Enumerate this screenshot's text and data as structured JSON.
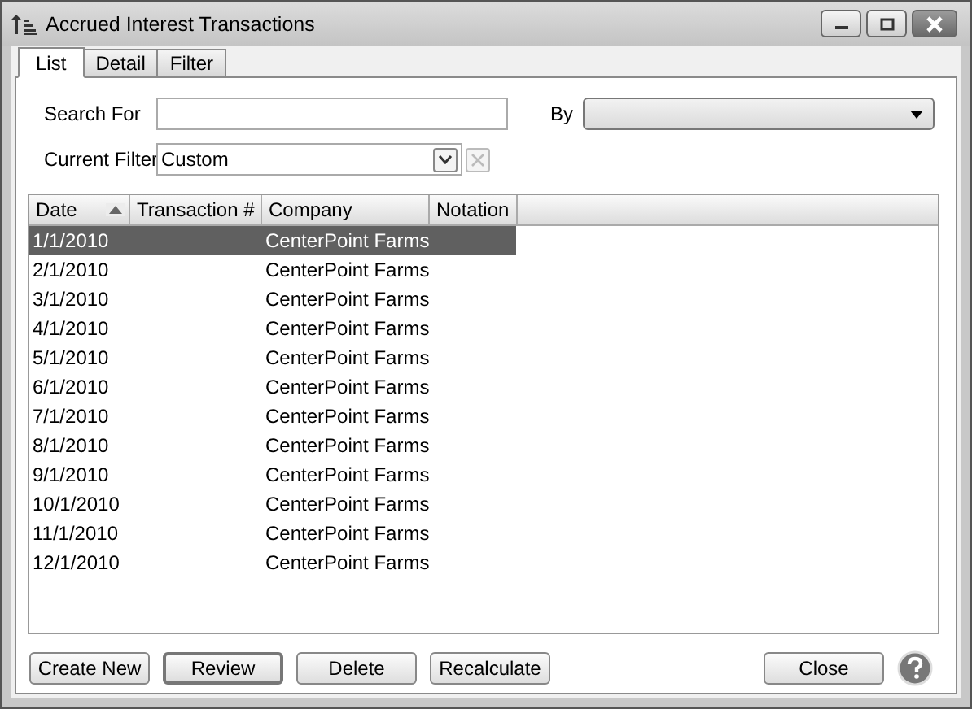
{
  "window": {
    "title": "Accrued Interest Transactions"
  },
  "tabs": [
    {
      "label": "List",
      "selected": true
    },
    {
      "label": "Detail",
      "selected": false
    },
    {
      "label": "Filter",
      "selected": false
    }
  ],
  "search": {
    "label": "Search For"
  },
  "by": {
    "label": "By"
  },
  "current_filter": {
    "label": "Current Filter",
    "value": "Custom"
  },
  "table": {
    "columns": [
      {
        "label": "Date",
        "sorted_ascending": true
      },
      {
        "label": "Transaction #",
        "sorted_ascending": false
      },
      {
        "label": "Company",
        "sorted_ascending": false
      },
      {
        "label": "Notation",
        "sorted_ascending": false
      }
    ],
    "rows": [
      {
        "date": "1/1/2010",
        "company": "CenterPoint Farms",
        "selected": true
      },
      {
        "date": "2/1/2010",
        "company": "CenterPoint Farms",
        "selected": false
      },
      {
        "date": "3/1/2010",
        "company": "CenterPoint Farms",
        "selected": false
      },
      {
        "date": "4/1/2010",
        "company": "CenterPoint Farms",
        "selected": false
      },
      {
        "date": "5/1/2010",
        "company": "CenterPoint Farms",
        "selected": false
      },
      {
        "date": "6/1/2010",
        "company": "CenterPoint Farms",
        "selected": false
      },
      {
        "date": "7/1/2010",
        "company": "CenterPoint Farms",
        "selected": false
      },
      {
        "date": "8/1/2010",
        "company": "CenterPoint Farms",
        "selected": false
      },
      {
        "date": "9/1/2010",
        "company": "CenterPoint Farms",
        "selected": false
      },
      {
        "date": "10/1/2010",
        "company": "CenterPoint Farms",
        "selected": false
      },
      {
        "date": "11/1/2010",
        "company": "CenterPoint Farms",
        "selected": false
      },
      {
        "date": "12/1/2010",
        "company": "CenterPoint Farms",
        "selected": false
      }
    ]
  },
  "buttons": [
    {
      "label": "Create New",
      "focused": false
    },
    {
      "label": "Review",
      "focused": true
    },
    {
      "label": "Delete",
      "focused": false
    },
    {
      "label": "Recalculate",
      "focused": false
    },
    {
      "label": "Close",
      "focused": false
    }
  ]
}
